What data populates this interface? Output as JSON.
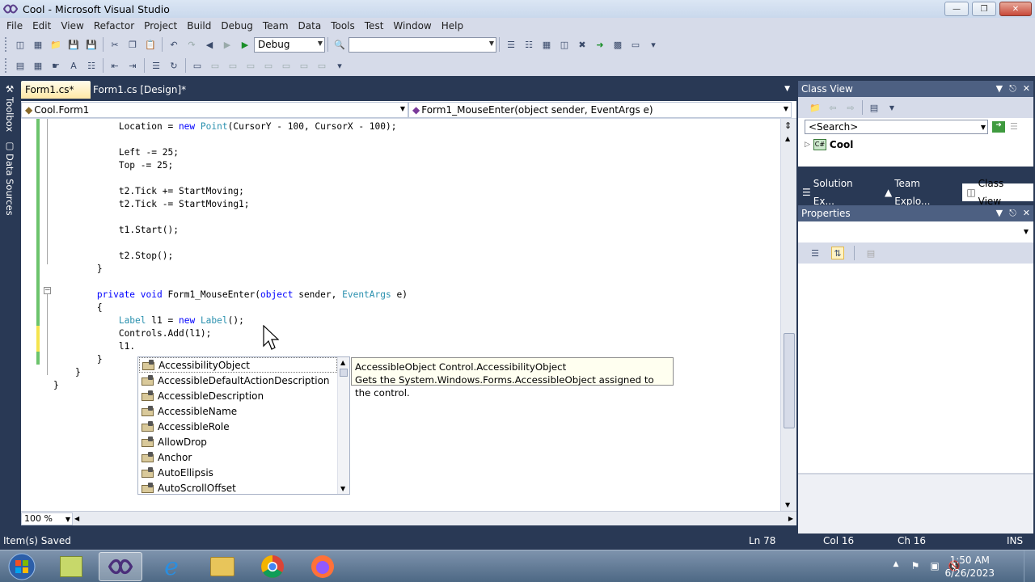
{
  "window": {
    "title": "Cool - Microsoft Visual Studio"
  },
  "menu": [
    "File",
    "Edit",
    "View",
    "Refactor",
    "Project",
    "Build",
    "Debug",
    "Team",
    "Data",
    "Tools",
    "Test",
    "Window",
    "Help"
  ],
  "toolbar": {
    "config_value": "Debug",
    "platform_value": ""
  },
  "left_tabs": {
    "toolbox": "Toolbox",
    "data_sources": "Data Sources"
  },
  "doc_tabs": [
    {
      "label": "Form1.cs*",
      "active": true
    },
    {
      "label": "Form1.cs [Design]*",
      "active": false
    }
  ],
  "nav": {
    "type_combo": "Cool.Form1",
    "member_combo": "Form1_MouseEnter(object sender, EventArgs e)"
  },
  "code_lines": [
    "            Location = new Point(CursorY - 100, CursorX - 100);",
    "",
    "            Left -= 25;",
    "            Top -= 25;",
    "",
    "            t2.Tick += StartMoving;",
    "            t2.Tick -= StartMoving1;",
    "",
    "            t1.Start();",
    "",
    "            t2.Stop();",
    "        }",
    "",
    "        private void Form1_MouseEnter(object sender, EventArgs e)",
    "        {",
    "            Label l1 = new Label();",
    "            Controls.Add(l1);",
    "            l1.",
    "        }",
    "    }",
    "}"
  ],
  "intellisense": {
    "items": [
      "AccessibilityObject",
      "AccessibleDefaultActionDescription",
      "AccessibleDescription",
      "AccessibleName",
      "AccessibleRole",
      "AllowDrop",
      "Anchor",
      "AutoEllipsis",
      "AutoScrollOffset"
    ],
    "selected_index": 0
  },
  "tooltip": {
    "signature": "AccessibleObject Control.AccessibilityObject",
    "description": "Gets the System.Windows.Forms.AccessibleObject assigned to the control."
  },
  "zoom": {
    "value": "100 %"
  },
  "class_view": {
    "title": "Class View",
    "search_placeholder": "<Search>",
    "tree_root": "Cool"
  },
  "bottom_tabs": [
    "Solution Ex...",
    "Team Explo...",
    "Class View"
  ],
  "properties": {
    "title": "Properties"
  },
  "status": {
    "message": "Item(s) Saved",
    "line": "Ln 78",
    "col": "Col 16",
    "ch": "Ch 16",
    "mode": "INS"
  },
  "clock": {
    "time": "1:50 AM",
    "date": "6/26/2023"
  },
  "colors": {
    "keyword": "#0000ff",
    "type": "#2b91af",
    "chrome": "#293955",
    "change_saved": "#6cc36c",
    "change_unsaved": "#f5e44e"
  }
}
